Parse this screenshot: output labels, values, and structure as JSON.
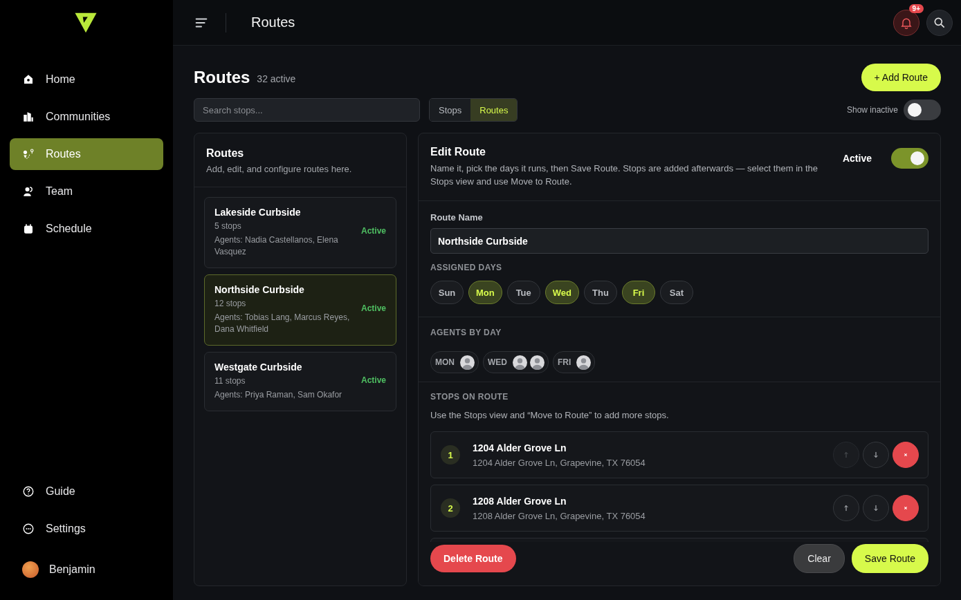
{
  "sidebar": {
    "nav": [
      {
        "label": "Home",
        "selected": false
      },
      {
        "label": "Communities",
        "selected": false
      },
      {
        "label": "Routes",
        "selected": true
      },
      {
        "label": "Team",
        "selected": false
      },
      {
        "label": "Schedule",
        "selected": false
      }
    ],
    "footer": [
      {
        "label": "Guide"
      },
      {
        "label": "Settings"
      }
    ],
    "user": {
      "name": "Benjamin"
    }
  },
  "topbar": {
    "title": "Routes",
    "notification_badge": "9+"
  },
  "page": {
    "title": "Routes",
    "count": "32 active",
    "add_button": "+ Add Route"
  },
  "search": {
    "placeholder": "Search stops..."
  },
  "view_tabs": [
    {
      "label": "Stops",
      "selected": false
    },
    {
      "label": "Routes",
      "selected": true
    }
  ],
  "show_inactive": {
    "label": "Show inactive",
    "on": false
  },
  "routes_panel": {
    "title": "Routes",
    "subtitle": "Add, edit, and configure routes here.",
    "routes": [
      {
        "name": "Lakeside Curbside",
        "stops": "5 stops",
        "agents": "Agents: Nadia Castellanos, Elena Vasquez",
        "status": "Active",
        "selected": false
      },
      {
        "name": "Northside Curbside",
        "stops": "12 stops",
        "agents": "Agents: Tobias Lang, Marcus Reyes, Dana Whitfield",
        "status": "Active",
        "selected": true
      },
      {
        "name": "Westgate Curbside",
        "stops": "11 stops",
        "agents": "Agents: Priya Raman, Sam Okafor",
        "status": "Active",
        "selected": false
      }
    ]
  },
  "editor": {
    "title": "Edit Route",
    "description": "Name it, pick the days it runs, then Save Route. Stops are added afterwards — select them in the Stops view and use Move to Route.",
    "active": {
      "label": "Active",
      "on": true
    },
    "route_name": {
      "label": "Route Name",
      "value": "Northside Curbside"
    },
    "days_label": "ASSIGNED DAYS",
    "days": [
      {
        "label": "Sun",
        "selected": false
      },
      {
        "label": "Mon",
        "selected": true
      },
      {
        "label": "Tue",
        "selected": false
      },
      {
        "label": "Wed",
        "selected": true
      },
      {
        "label": "Thu",
        "selected": false
      },
      {
        "label": "Fri",
        "selected": true
      },
      {
        "label": "Sat",
        "selected": false
      }
    ],
    "agents_label": "AGENTS BY DAY",
    "agents_by_day": [
      {
        "day": "MON",
        "agents": [
          {
            "kind": "avatar"
          }
        ]
      },
      {
        "day": "WED",
        "agents": [
          {
            "kind": "avatar"
          },
          {
            "kind": "avatar"
          }
        ]
      },
      {
        "day": "FRI",
        "agents": [
          {
            "kind": "avatar"
          }
        ]
      }
    ],
    "stops_label": "STOPS ON ROUTE",
    "stops_hint": "Use the Stops view and “Move to Route” to add more stops.",
    "stops": [
      {
        "kind": "stop",
        "number": "1",
        "title": "1204 Alder Grove Ln",
        "address": "1204 Alder Grove Ln, Grapevine, TX 76054",
        "up_disabled": true
      },
      {
        "kind": "stop",
        "number": "2",
        "title": "1208 Alder Grove Ln",
        "address": "1208 Alder Grove Ln, Grapevine, TX 76054",
        "up_disabled": false
      },
      {
        "kind": "partial"
      }
    ],
    "buttons": {
      "delete": "Delete Route",
      "clear": "Clear",
      "save": "Save Route"
    }
  }
}
